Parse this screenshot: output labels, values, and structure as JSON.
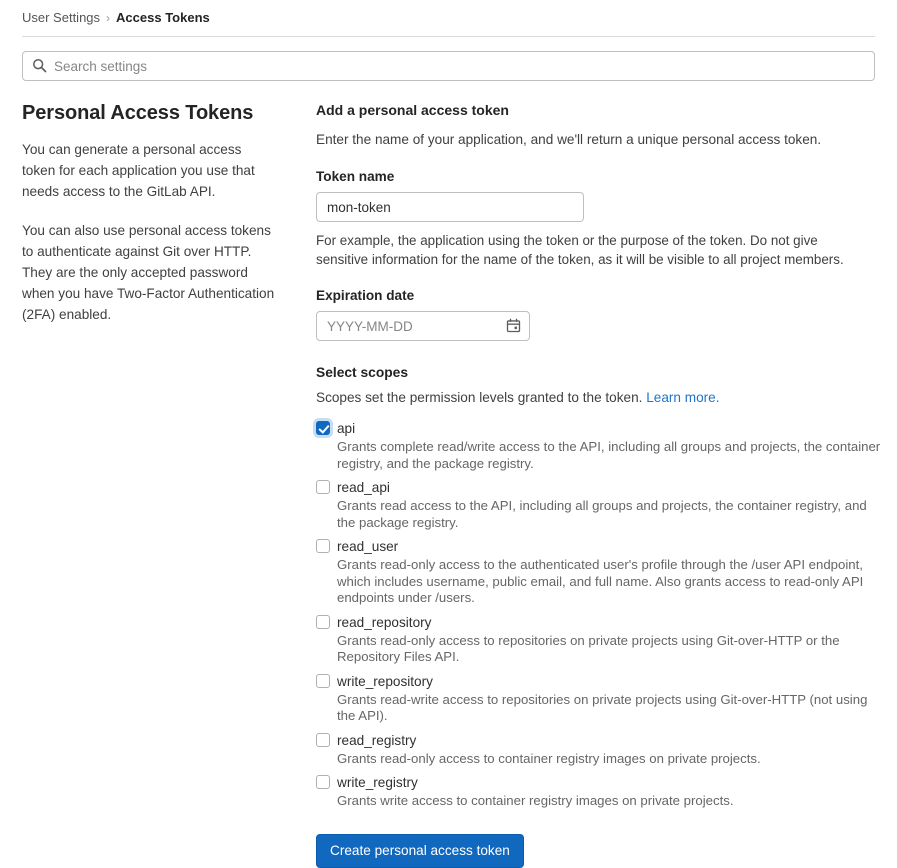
{
  "breadcrumb": {
    "parent": "User Settings",
    "separator": "›",
    "current": "Access Tokens"
  },
  "search": {
    "placeholder": "Search settings",
    "value": "",
    "icon": "search-icon"
  },
  "sidebar": {
    "title": "Personal Access Tokens",
    "paragraphs": [
      "You can generate a personal access token for each application you use that needs access to the GitLab API.",
      "You can also use personal access tokens to authenticate against Git over HTTP. They are the only accepted password when you have Two-Factor Authentication (2FA) enabled."
    ]
  },
  "form": {
    "title": "Add a personal access token",
    "subtitle": "Enter the name of your application, and we'll return a unique personal access token.",
    "token_name": {
      "label": "Token name",
      "value": "mon-token",
      "placeholder": "",
      "help": "For example, the application using the token or the purpose of the token. Do not give sensitive information for the name of the token, as it will be visible to all project members."
    },
    "expiration": {
      "label": "Expiration date",
      "value": "",
      "placeholder": "YYYY-MM-DD",
      "icon": "calendar-icon"
    },
    "scopes": {
      "title": "Select scopes",
      "subtitle_text": "Scopes set the permission levels granted to the token. ",
      "learn_more": "Learn more.",
      "items": [
        {
          "name": "api",
          "checked": true,
          "description": "Grants complete read/write access to the API, including all groups and projects, the container registry, and the package registry."
        },
        {
          "name": "read_api",
          "checked": false,
          "description": "Grants read access to the API, including all groups and projects, the container registry, and the package registry."
        },
        {
          "name": "read_user",
          "checked": false,
          "description": "Grants read-only access to the authenticated user's profile through the /user API endpoint, which includes username, public email, and full name. Also grants access to read-only API endpoints under /users."
        },
        {
          "name": "read_repository",
          "checked": false,
          "description": "Grants read-only access to repositories on private projects using Git-over-HTTP or the Repository Files API."
        },
        {
          "name": "write_repository",
          "checked": false,
          "description": "Grants read-write access to repositories on private projects using Git-over-HTTP (not using the API)."
        },
        {
          "name": "read_registry",
          "checked": false,
          "description": "Grants read-only access to container registry images on private projects."
        },
        {
          "name": "write_registry",
          "checked": false,
          "description": "Grants write access to container registry images on private projects."
        }
      ]
    },
    "submit_label": "Create personal access token"
  },
  "colors": {
    "accent": "#1068bf",
    "link": "#1f75cb",
    "text": "#303030",
    "muted": "#666666",
    "border": "#bfbfbf"
  }
}
